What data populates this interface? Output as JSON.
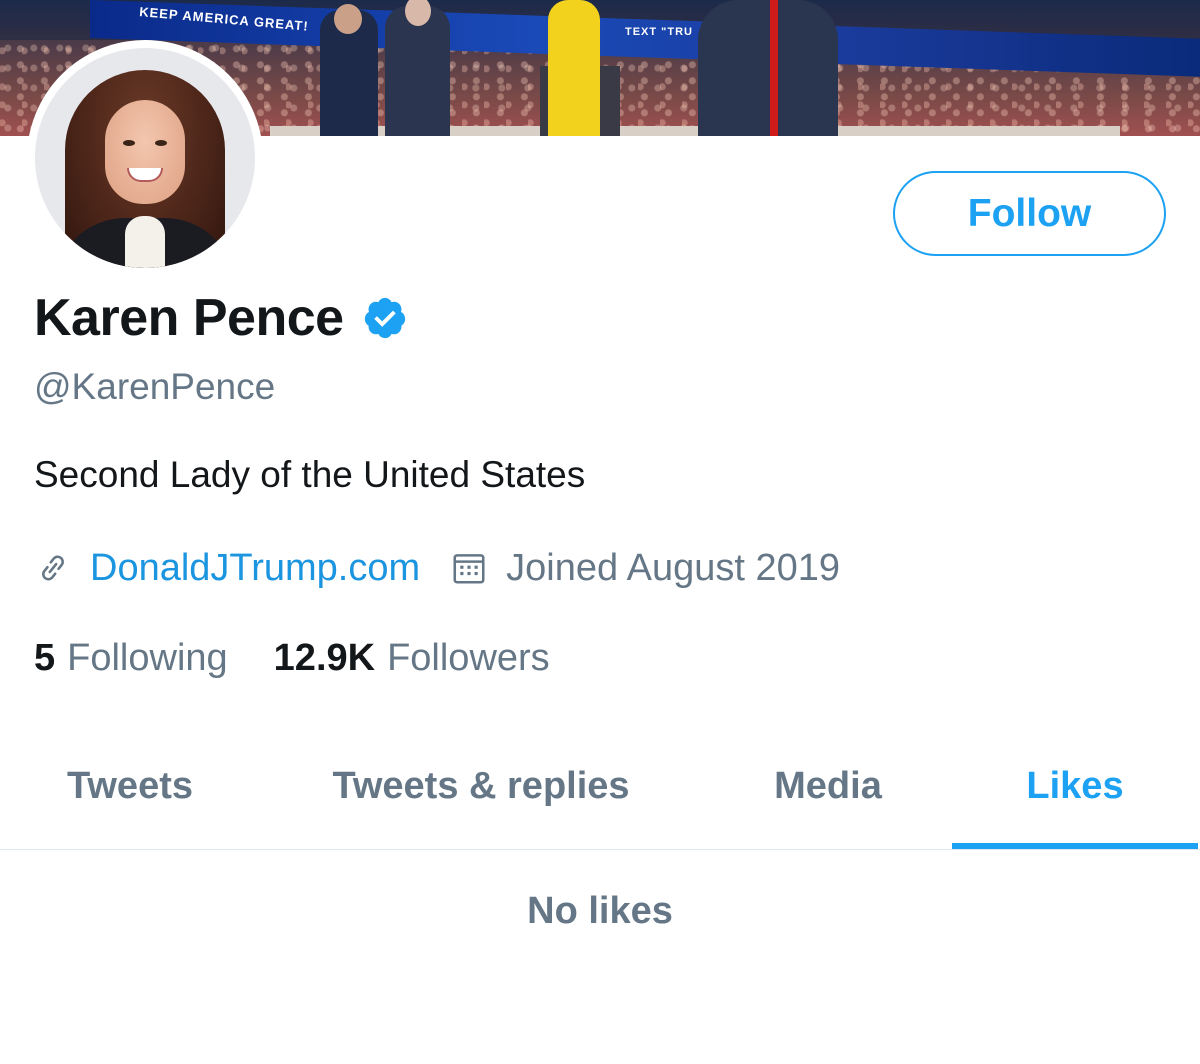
{
  "banner": {
    "sign_text": "KEEP AMERICA GREAT!",
    "sign_text_2": "TEXT \"TRU"
  },
  "profile": {
    "display_name": "Karen Pence",
    "verified": true,
    "handle": "@KarenPence",
    "bio": "Second Lady of the United States",
    "website": "DonaldJTrump.com",
    "joined": "Joined August 2019",
    "following_count": "5",
    "following_label": "Following",
    "followers_count": "12.9K",
    "followers_label": "Followers"
  },
  "actions": {
    "follow_label": "Follow"
  },
  "tabs": [
    {
      "label": "Tweets",
      "active": false
    },
    {
      "label": "Tweets & replies",
      "active": false
    },
    {
      "label": "Media",
      "active": false
    },
    {
      "label": "Likes",
      "active": true
    }
  ],
  "content": {
    "empty_message": "No likes"
  },
  "colors": {
    "accent": "#1da1f2",
    "link": "#1b95e0",
    "muted": "#657786",
    "text": "#14171a"
  },
  "icons": {
    "verified": "verified-badge-icon",
    "link": "link-icon",
    "calendar": "calendar-icon"
  }
}
